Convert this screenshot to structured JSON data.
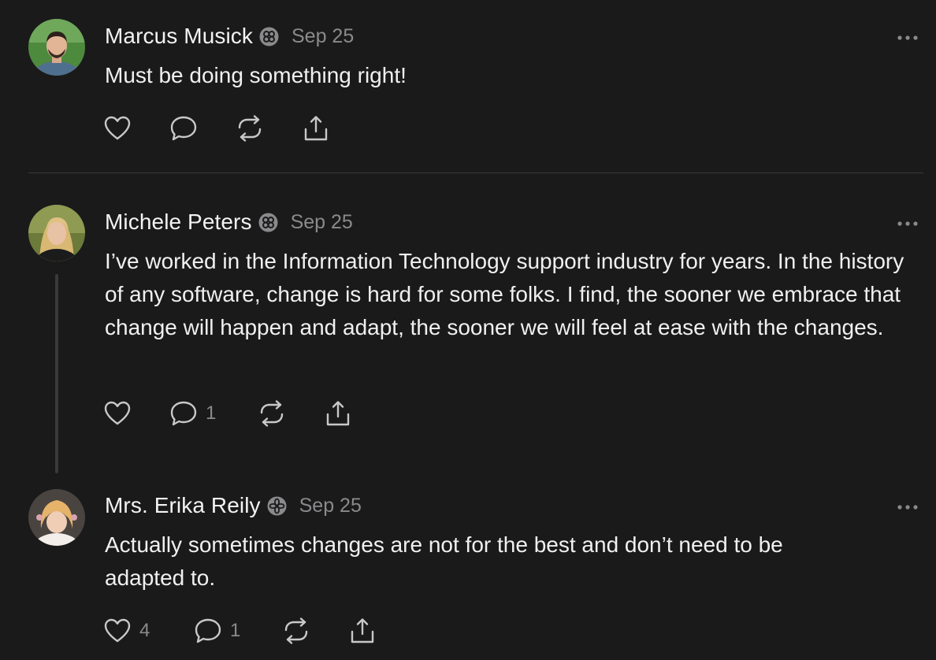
{
  "posts": [
    {
      "author": "Marcus Musick",
      "date": "Sep 25",
      "text": "Must be doing something right!",
      "like_count": "",
      "reply_count": ""
    },
    {
      "author": "Michele Peters",
      "date": "Sep 25",
      "text": "I’ve worked in the Information Technology support industry for years. In the history of any software, change is hard for some folks. I find, the sooner we embrace that change will happen and adapt, the sooner we will feel at ease with the changes.",
      "like_count": "",
      "reply_count": "1"
    },
    {
      "author": "Mrs. Erika Reily",
      "date": "Sep 25",
      "text": "Actually sometimes changes are not for the best and don’t need to be adapted to.",
      "like_count": "4",
      "reply_count": "1"
    }
  ],
  "icons": {
    "like": "heart-icon",
    "reply": "speech-bubble-icon",
    "repost": "repost-icon",
    "share": "share-icon",
    "more": "ellipsis-icon",
    "badge": "verified-badge-icon"
  },
  "colors": {
    "background": "#1a1a1b",
    "text": "#f0f0f0",
    "muted": "#8a8a8c",
    "divider": "#3a3a3c"
  }
}
